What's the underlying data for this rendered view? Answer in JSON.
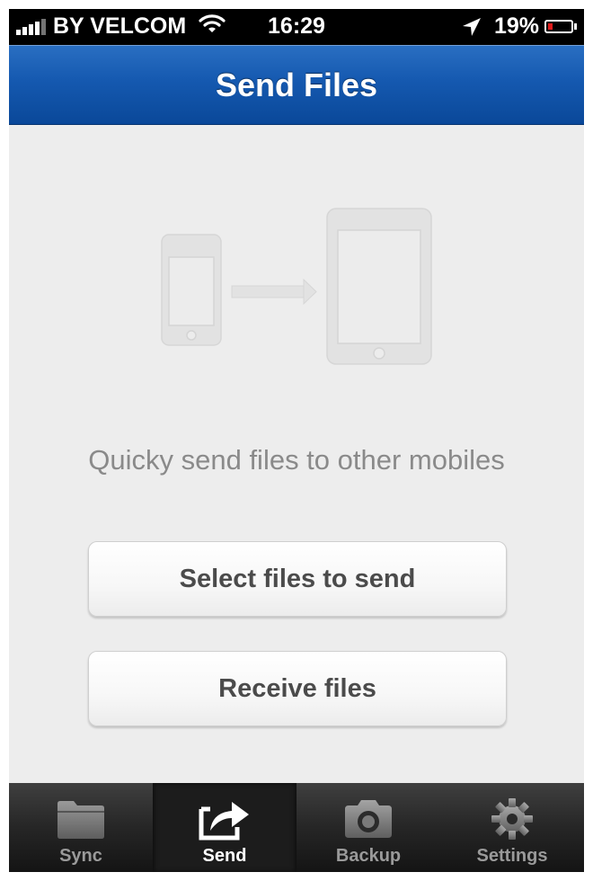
{
  "status_bar": {
    "carrier": "BY VELCOM",
    "time": "16:29",
    "battery": "19%",
    "battery_level": 0.19
  },
  "nav": {
    "title": "Send Files"
  },
  "main": {
    "tagline": "Quicky send files to other mobiles",
    "buttons": [
      {
        "label": "Select files to send"
      },
      {
        "label": "Receive files"
      }
    ]
  },
  "tab_bar": {
    "tabs": [
      {
        "label": "Sync",
        "icon": "folder-icon"
      },
      {
        "label": "Send",
        "icon": "send-share-icon",
        "active": true
      },
      {
        "label": "Backup",
        "icon": "camera-icon"
      },
      {
        "label": "Settings",
        "icon": "gear-icon"
      }
    ]
  },
  "colors": {
    "nav_blue": "#1559b0",
    "battery_low": "#e01b1b",
    "background": "#ededed"
  }
}
